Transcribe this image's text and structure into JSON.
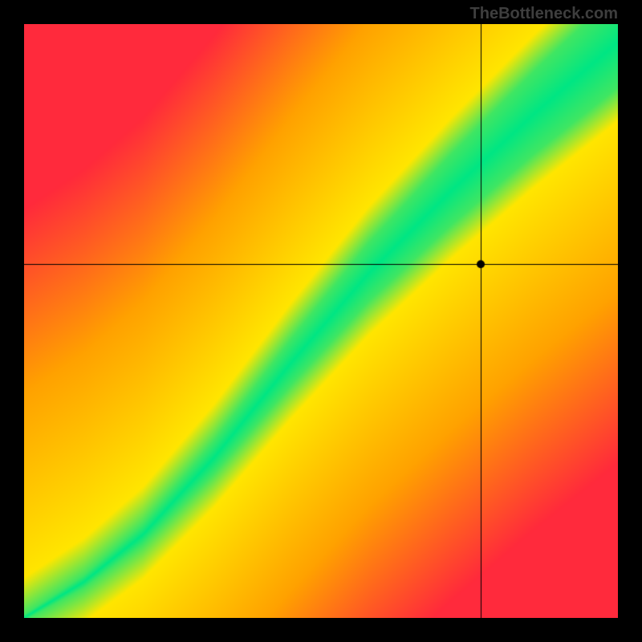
{
  "watermark": "TheBottleneck.com",
  "chart_data": {
    "type": "heatmap",
    "title": "",
    "xlabel": "",
    "ylabel": "",
    "grid": false,
    "size": 740,
    "colors": {
      "good": "#00e684",
      "mid": "#ffe600",
      "bad": "#ff2a3c",
      "warm": "#ffa200"
    },
    "diagonal_curve": {
      "description": "Ideal-match band: a slightly S-curved diagonal from bottom-left to top-right in green, surrounded by yellow, fading to red away from the band.",
      "control_points_normalized": [
        {
          "x": 0.0,
          "y": 0.0
        },
        {
          "x": 0.1,
          "y": 0.06
        },
        {
          "x": 0.2,
          "y": 0.14
        },
        {
          "x": 0.32,
          "y": 0.27
        },
        {
          "x": 0.45,
          "y": 0.43
        },
        {
          "x": 0.58,
          "y": 0.58
        },
        {
          "x": 0.72,
          "y": 0.72
        },
        {
          "x": 0.86,
          "y": 0.85
        },
        {
          "x": 1.0,
          "y": 0.97
        }
      ],
      "green_half_width_norm_at_0": 0.005,
      "green_half_width_norm_at_1": 0.08,
      "yellow_half_width_extra_norm": 0.06
    },
    "crosshair": {
      "x_norm": 0.77,
      "y_norm": 0.595
    },
    "marker": {
      "x_norm": 0.77,
      "y_norm": 0.595,
      "radius_px": 5,
      "color": "#000000"
    }
  }
}
